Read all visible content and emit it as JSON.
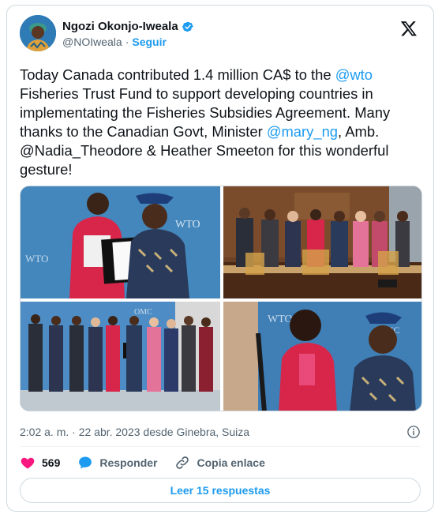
{
  "author": {
    "name": "Ngozi Okonjo-Iweala",
    "handle": "@NOIweala",
    "separator": "·",
    "follow_label": "Seguir"
  },
  "tweet": {
    "part1": "Today Canada contributed 1.4 million CA$ to the ",
    "mention_wto": "@wto",
    "part2": " Fisheries Trust Fund to support developing countries in implementating the Fisheries Subsidies Agreement. Many thanks to the Canadian Govt, Minister ",
    "mention_mary": "@mary_ng",
    "part3": ", Amb. @Nadia_Theodore & Heather Smeeton for this wonderful gesture!"
  },
  "media": {
    "photo_signs": [
      "WTO",
      "WTO",
      "OMC",
      "WTO",
      "OMC"
    ]
  },
  "meta": {
    "timestamp": "2:02 a. m. · 22 abr. 2023 desde Ginebra, Suiza"
  },
  "actions": {
    "likes": "569",
    "reply_label": "Responder",
    "copy_label": "Copia enlace"
  },
  "read_replies_label": "Leer 15 respuestas",
  "colors": {
    "accent": "#1d9bf0",
    "like": "#f91880",
    "text": "#0f1419",
    "muted": "#536471"
  }
}
